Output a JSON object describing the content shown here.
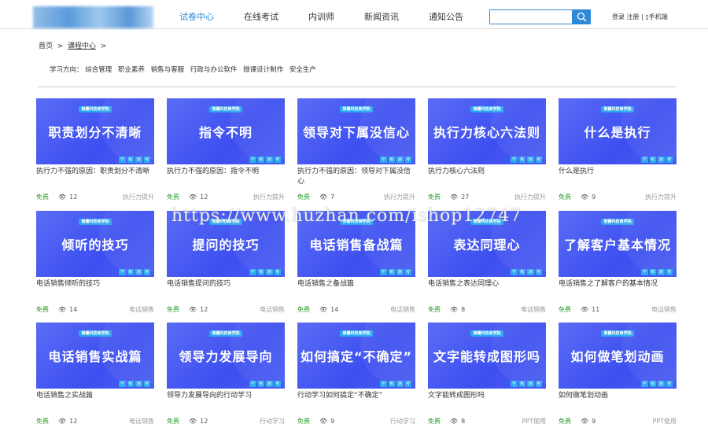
{
  "header": {
    "nav": [
      "试卷中心",
      "在线考试",
      "内训师",
      "新闻资讯",
      "通知公告"
    ],
    "search_placeholder": "",
    "login": "登录",
    "register": "注册",
    "mobile": "手机端"
  },
  "breadcrumb": {
    "home": "首页",
    "current": "课程中心"
  },
  "directions": {
    "label": "学习方向：",
    "items": [
      "综合管理",
      "职业素养",
      "销售与客服",
      "行政与办公软件",
      "微课设计制作",
      "安全生产"
    ]
  },
  "card_common": {
    "brand": "微蕾科技商学院",
    "tags": [
      "学",
      "练",
      "测",
      "考"
    ],
    "free": "免费"
  },
  "courses": [
    {
      "cover": "职责划分不清晰",
      "title": "执行力不强的原因：职责划分不清晰",
      "views": "12",
      "category": "执行力提升"
    },
    {
      "cover": "指令不明",
      "title": "执行力不强的原因：指令不明",
      "views": "12",
      "category": "执行力提升"
    },
    {
      "cover": "领导对下属没信心",
      "title": "执行力不强的原因：领导对下属没信心",
      "views": "7",
      "category": "执行力提升"
    },
    {
      "cover": "执行力核心六法则",
      "title": "执行力核心六法则",
      "views": "27",
      "category": "执行力提升"
    },
    {
      "cover": "什么是执行",
      "title": "什么是执行",
      "views": "9",
      "category": "执行力提升"
    },
    {
      "cover": "倾听的技巧",
      "title": "电话销售倾听的技巧",
      "views": "14",
      "category": "电话销售"
    },
    {
      "cover": "提问的技巧",
      "title": "电话销售提问的技巧",
      "views": "12",
      "category": "电话销售"
    },
    {
      "cover": "电话销售备战篇",
      "title": "电话销售之备战篇",
      "views": "14",
      "category": "电话销售"
    },
    {
      "cover": "表达同理心",
      "title": "电话销售之表达同理心",
      "views": "8",
      "category": "电话销售"
    },
    {
      "cover": "了解客户基本情况",
      "title": "电话销售之了解客户的基本情况",
      "views": "11",
      "category": "电话销售"
    },
    {
      "cover": "电话销售实战篇",
      "title": "电话销售之实战篇",
      "views": "12",
      "category": "电话销售"
    },
    {
      "cover": "领导力发展导向",
      "title": "领导力发展导向的行动学习",
      "views": "12",
      "category": "行动学习"
    },
    {
      "cover": "如何搞定“不确定”",
      "title": "行动学习如何搞定“不确定”",
      "views": "9",
      "category": "行动学习"
    },
    {
      "cover": "文字能转成图形吗",
      "title": "文字能转成图形吗",
      "views": "8",
      "category": "PPT使用"
    },
    {
      "cover": "如何做笔划动画",
      "title": "如何做笔划动画",
      "views": "9",
      "category": "PPT使用"
    }
  ],
  "watermark": "https://www.huzhan.com/ishop12747"
}
